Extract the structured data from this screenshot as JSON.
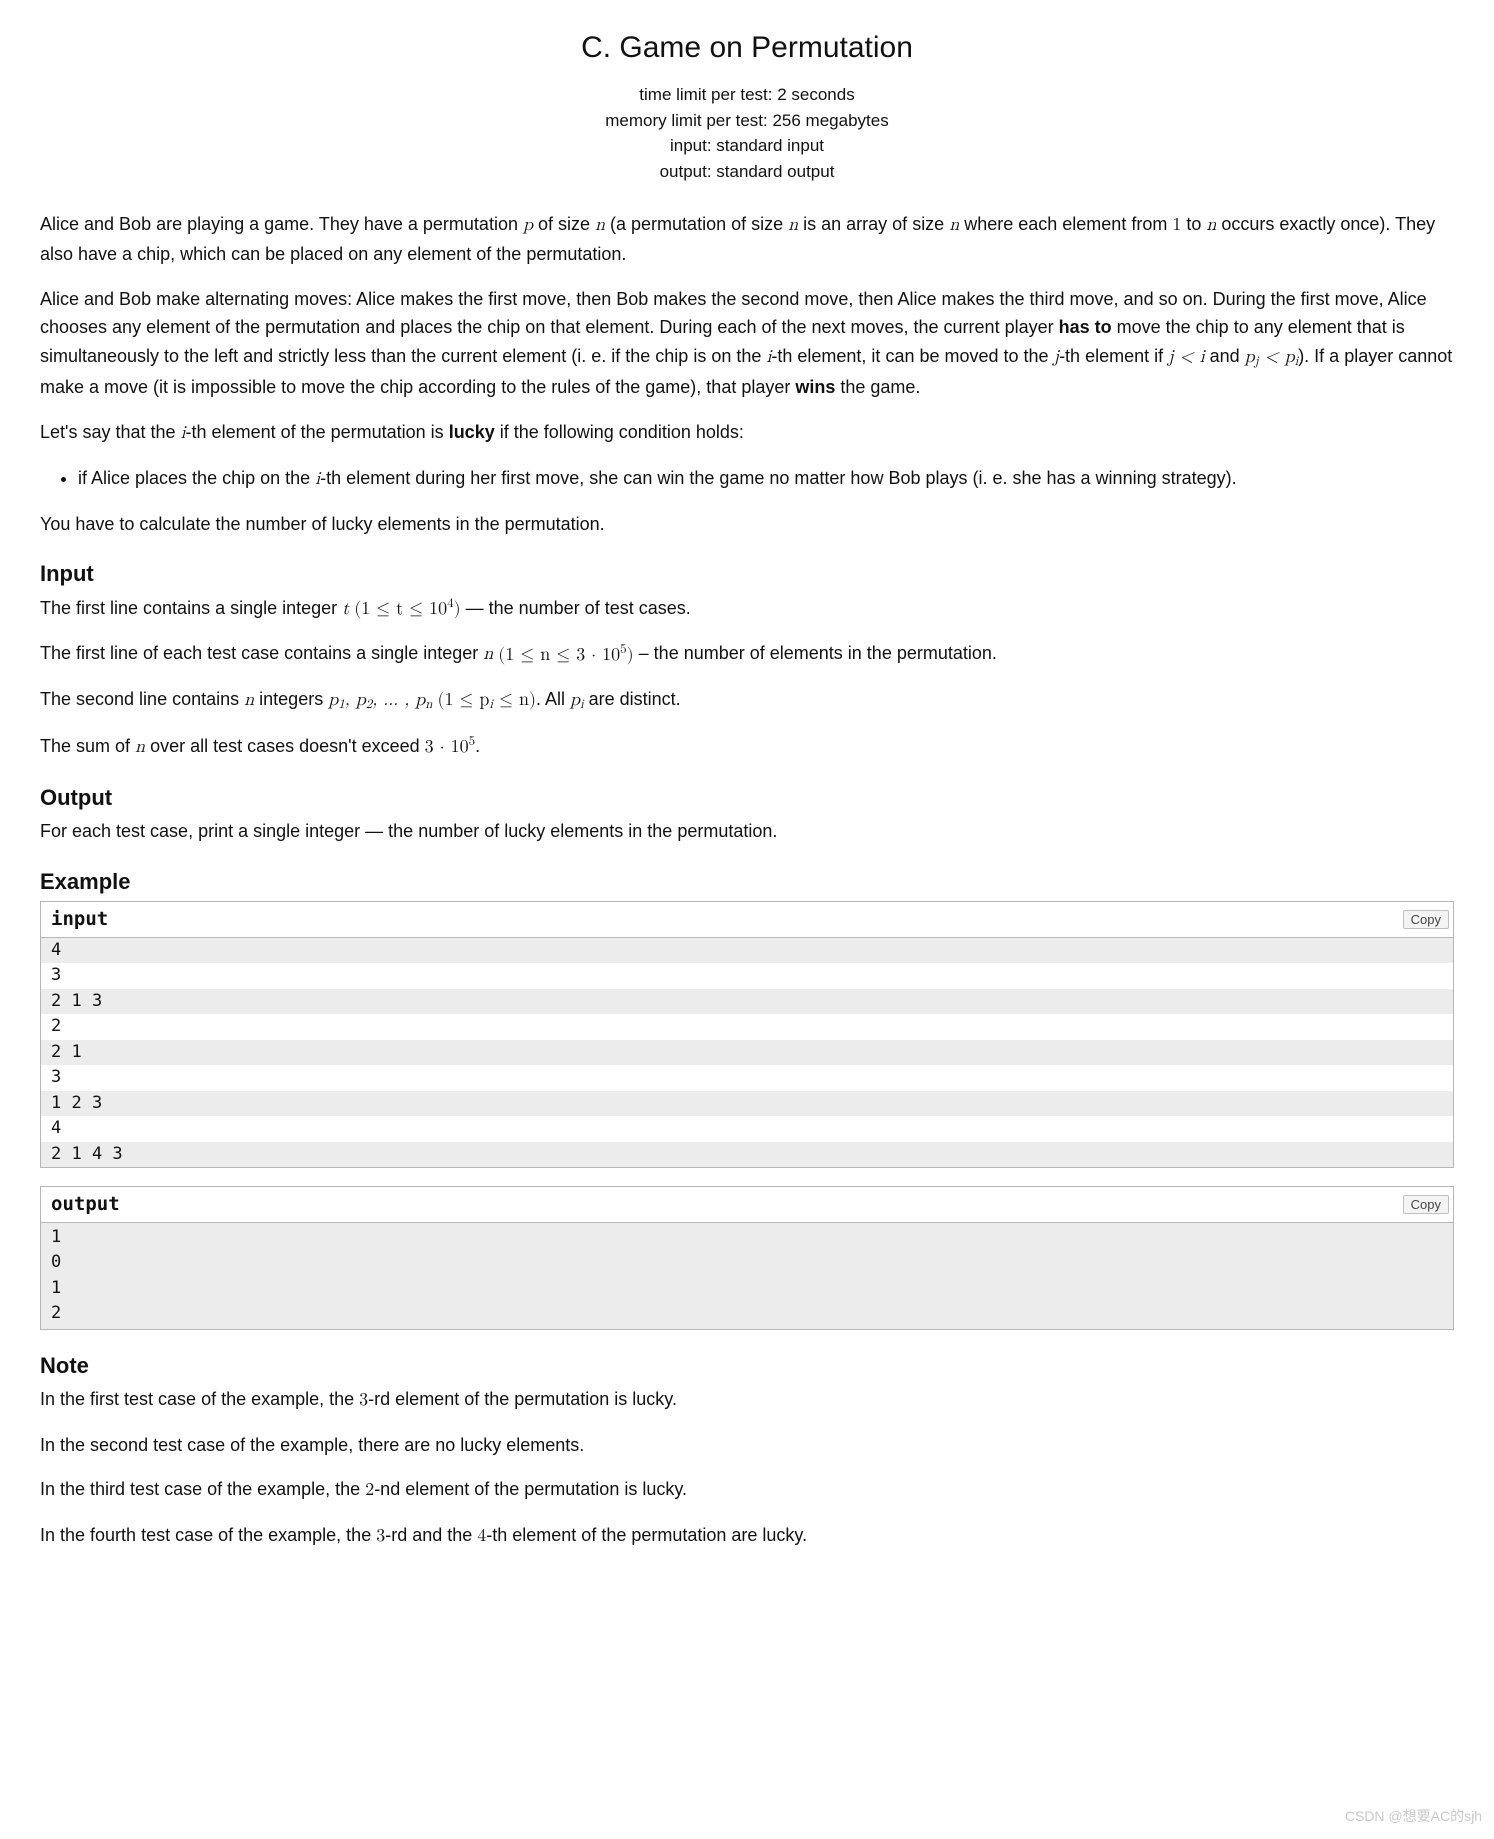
{
  "header": {
    "title": "C. Game on Permutation",
    "time_limit": "time limit per test: 2 seconds",
    "memory_limit": "memory limit per test: 256 megabytes",
    "input": "input: standard input",
    "output": "output: standard output"
  },
  "statement": {
    "p1_a": "Alice and Bob are playing a game. They have a permutation ",
    "p1_b": " of size ",
    "p1_c": " (a permutation of size ",
    "p1_d": " is an array of size ",
    "p1_e": " where each element from ",
    "p1_f": " to ",
    "p1_g": " occurs exactly once). They also have a chip, which can be placed on any element of the permutation.",
    "p2_a": "Alice and Bob make alternating moves: Alice makes the first move, then Bob makes the second move, then Alice makes the third move, and so on. During the first move, Alice chooses any element of the permutation and places the chip on that element. During each of the next moves, the current player ",
    "p2_hasto": "has to",
    "p2_b": " move the chip to any element that is simultaneously to the left and strictly less than the current element (i. e. if the chip is on the ",
    "p2_c": "-th element, it can be moved to the ",
    "p2_d": "-th element if ",
    "p2_e": " and ",
    "p2_f": "). If a player cannot make a move (it is impossible to move the chip according to the rules of the game), that player ",
    "p2_wins": "wins",
    "p2_g": " the game.",
    "p3_a": "Let's say that the ",
    "p3_b": "-th element of the permutation is ",
    "p3_lucky": "lucky",
    "p3_c": " if the following condition holds:",
    "li_a": "if Alice places the chip on the ",
    "li_b": "-th element during her first move, she can win the game no matter how Bob plays (i. e. she has a winning strategy).",
    "p4": "You have to calculate the number of lucky elements in the permutation."
  },
  "sections": {
    "input": "Input",
    "output": "Output",
    "example": "Example",
    "note": "Note"
  },
  "input": {
    "p1_a": "The first line contains a single integer ",
    "p1_b": " — the number of test cases.",
    "p2_a": "The first line of each test case contains a single integer ",
    "p2_b": " – the number of elements in the permutation.",
    "p3_a": "The second line contains ",
    "p3_b": " integers ",
    "p3_c": ". All ",
    "p3_d": " are distinct.",
    "p4_a": "The sum of ",
    "p4_b": " over all test cases doesn't exceed ",
    "p4_c": "."
  },
  "output": {
    "p1": "For each test case, print a single integer — the number of lucky elements in the permutation."
  },
  "example": {
    "input_label": "input",
    "output_label": "output",
    "copy": "Copy",
    "input_rows": [
      "4",
      "3",
      "2 1 3",
      "2",
      "2 1",
      "3",
      "1 2 3",
      "4",
      "2 1 4 3"
    ],
    "output_rows": [
      "1",
      "0",
      "1",
      "2"
    ]
  },
  "note": {
    "n1_a": "In the first test case of the example, the ",
    "n1_b": "-rd element of the permutation is lucky.",
    "n2": "In the second test case of the example, there are no lucky elements.",
    "n3_a": "In the third test case of the example, the ",
    "n3_b": "-nd element of the permutation is lucky.",
    "n4_a": "In the fourth test case of the example, the ",
    "n4_b": "-rd and the ",
    "n4_c": "-th element of the permutation are lucky."
  },
  "math": {
    "p": "p",
    "n": "n",
    "one": "1",
    "i": "i",
    "j": "j",
    "t": "t",
    "jlti": "j < i",
    "pjltpi_a": "p",
    "pjltpi_b": " < p",
    "t_range_a": "(1 ≤ t ≤ 10",
    "t_range_b": ")",
    "n_range_a": "(1 ≤ n ≤ 3 · 10",
    "n_range_b": ")",
    "p_list": "p",
    "p_range_a": "(1 ≤ p",
    "p_range_b": " ≤ n)",
    "sum_limit": "3 · 10",
    "three": "3",
    "two": "2",
    "four": "4",
    "five": "5"
  },
  "watermark": "CSDN @想要AC的sjh"
}
